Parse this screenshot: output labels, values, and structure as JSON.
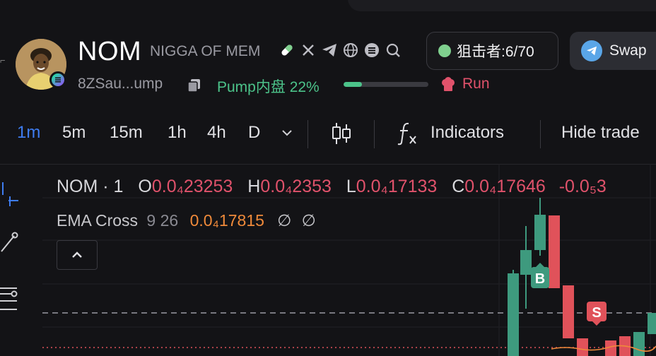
{
  "header": {
    "symbol": "NOM",
    "name": "NIGGA OF MEM",
    "address": "8ZSau...ump",
    "pump_label": "Pump内盘 22%",
    "pump_progress": 0.22,
    "run_label": "Run",
    "icons": [
      "pill-icon",
      "x-icon",
      "telegram-icon",
      "globe-icon",
      "list-icon",
      "search-icon"
    ]
  },
  "sniper": {
    "label": "狙击者:6/70",
    "dot_color": "#7fd08e"
  },
  "swap": {
    "label": "Swap"
  },
  "toolbar": {
    "timeframes": [
      {
        "label": "1m",
        "active": true
      },
      {
        "label": "5m",
        "active": false
      },
      {
        "label": "15m",
        "active": false
      },
      {
        "label": "1h",
        "active": false
      },
      {
        "label": "4h",
        "active": false
      },
      {
        "label": "D",
        "active": false
      }
    ],
    "indicators_label": "Indicators",
    "hide_trades_label": "Hide trade"
  },
  "legend": {
    "symbol": "NOM · 1",
    "open_label": "O",
    "open": "0.0₄23253",
    "high_label": "H",
    "high": "0.0₄2353",
    "low_label": "L",
    "low": "0.0₄17133",
    "close_label": "C",
    "close": "0.0₄17646",
    "change": "-0.0₅3"
  },
  "ema": {
    "name": "EMA Cross",
    "params": "9 26",
    "value": "0.0₄17815",
    "na1": "∅",
    "na2": "∅"
  },
  "markers": {
    "buy": "B",
    "sell": "S"
  },
  "colors": {
    "up": "#3e9a7e",
    "down": "#e0525a",
    "accent": "#3e7cf0",
    "pump": "#4cc38a",
    "ema": "#f08a3a"
  }
}
